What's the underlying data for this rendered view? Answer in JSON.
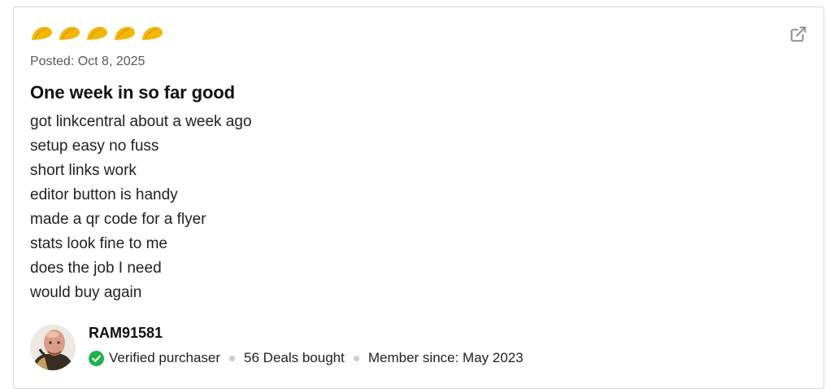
{
  "review": {
    "rating": 5,
    "rating_icon": "taco-icon",
    "posted": "Posted: Oct 8, 2025",
    "title": "One week in so far good",
    "lines": [
      "got linkcentral about a week ago",
      "setup easy no fuss",
      "short links work",
      "editor button is handy",
      "made a qr code for a flyer",
      "stats look fine to me",
      "does the job I need",
      "would buy again"
    ]
  },
  "author": {
    "username": "RAM91581",
    "verified": "Verified purchaser",
    "deals": "56 Deals bought",
    "member_since": "Member since: May 2023"
  },
  "colors": {
    "taco": "#f2b705",
    "verified": "#22b14c",
    "dot": "#c9cbd1",
    "icon": "#8a8f98"
  }
}
